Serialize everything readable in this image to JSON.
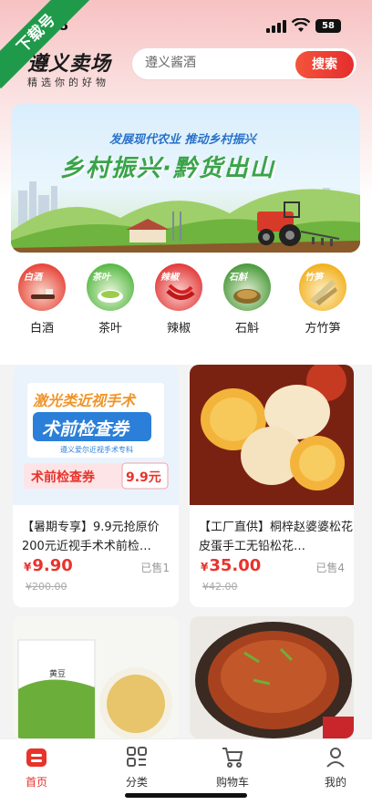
{
  "status_bar": {
    "time": "8",
    "battery": "58"
  },
  "ribbon": {
    "label": "下载号"
  },
  "header": {
    "logo_title": "遵义卖场",
    "logo_subtitle": "精选你的好物",
    "search_placeholder": "遵义酱酒",
    "search_button": "搜索"
  },
  "banner": {
    "line1": "发展现代农业  推动乡村振兴",
    "line2": "乡村振兴·黔货出山"
  },
  "categories": [
    {
      "tag": "白酒",
      "label": "白酒",
      "color": "#e8443a"
    },
    {
      "tag": "茶叶",
      "label": "茶叶",
      "color": "#58b846"
    },
    {
      "tag": "辣椒",
      "label": "辣椒",
      "color": "#e23b3b"
    },
    {
      "tag": "石斛",
      "label": "石斛",
      "color": "#4a9a3c"
    },
    {
      "tag": "竹笋",
      "label": "方竹笋",
      "color": "#f2b01e"
    }
  ],
  "products": [
    {
      "img_line1": "激光类近视手术",
      "img_line2": "术前检查券",
      "img_line3": "遵义爱尔近视手术专科",
      "img_line4": "术前检查券",
      "img_price_tag": "9.9元",
      "title": "【暑期专享】9.9元抢原价200元近视手术术前检…",
      "price": "9.90",
      "sold": "已售1",
      "original_price": "200.00"
    },
    {
      "title": "【工厂直供】桐梓赵婆婆松花皮蛋手工无铅松花…",
      "price": "35.00",
      "sold": "已售4",
      "original_price": "42.00"
    },
    {
      "img_label": "黄豆"
    },
    {}
  ],
  "tabbar": [
    {
      "label": "首页",
      "active": true
    },
    {
      "label": "分类",
      "active": false
    },
    {
      "label": "购物车",
      "active": false
    },
    {
      "label": "我的",
      "active": false
    }
  ],
  "colors": {
    "accent": "#e8332b",
    "brand_green": "#1f9a4a"
  }
}
